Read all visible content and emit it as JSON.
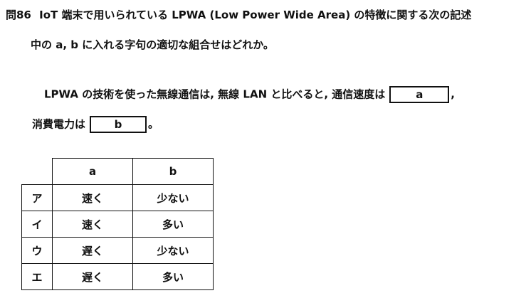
{
  "question": {
    "number": "問86",
    "line1": "IoT 端末で用いられている LPWA (Low Power Wide Area) の特徴に関する次の記述",
    "line2": "中の a, b に入れる字句の適切な組合せはどれか。"
  },
  "body": {
    "line1_text": "LPWA の技術を使った無線通信は, 無線 LAN と比べると, 通信速度は",
    "blank_a": "a",
    "line1_end": ",",
    "line2_text": "消費電力は",
    "blank_b": "b",
    "line2_end": "。"
  },
  "table": {
    "headers": [
      "",
      "a",
      "b"
    ],
    "rows": [
      {
        "key": "ア",
        "a": "速く",
        "b": "少ない"
      },
      {
        "key": "イ",
        "a": "速く",
        "b": "多い"
      },
      {
        "key": "ウ",
        "a": "遅く",
        "b": "少ない"
      },
      {
        "key": "エ",
        "a": "遅く",
        "b": "多い"
      }
    ]
  }
}
